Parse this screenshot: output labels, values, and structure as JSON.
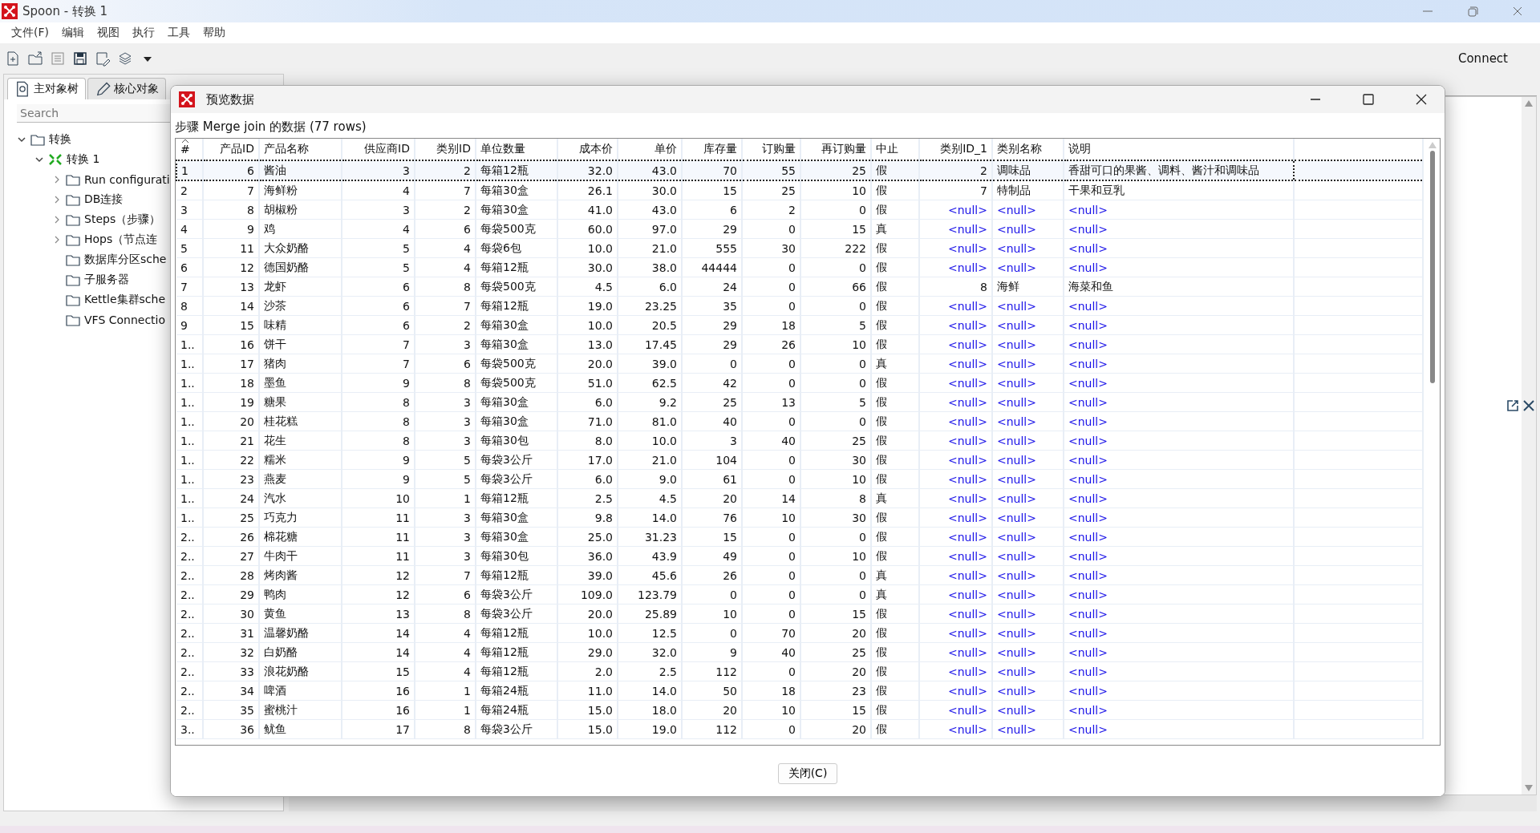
{
  "window": {
    "title": "Spoon - 转换 1"
  },
  "menu": [
    "文件(F)",
    "编辑",
    "视图",
    "执行",
    "工具",
    "帮助"
  ],
  "toolbar": {
    "connect": "Connect"
  },
  "sidebar": {
    "tabs": [
      {
        "label": "主对象树",
        "selected": true
      },
      {
        "label": "核心对象",
        "selected": false
      }
    ],
    "search": {
      "placeholder": "Search"
    },
    "tree": [
      {
        "label": "转换",
        "kind": "folder",
        "expanded": true,
        "children": [
          {
            "label": "转换 1",
            "kind": "transformation",
            "expanded": true,
            "children": [
              {
                "label": "Run configurati",
                "kind": "folder",
                "expanded": false
              },
              {
                "label": "DB连接",
                "kind": "folder",
                "expanded": false
              },
              {
                "label": "Steps（步骤）",
                "kind": "folder",
                "expanded": false
              },
              {
                "label": "Hops（节点连",
                "kind": "folder",
                "expanded": false
              },
              {
                "label": "数据库分区sche",
                "kind": "folder"
              },
              {
                "label": "子服务器",
                "kind": "folder"
              },
              {
                "label": "Kettle集群sche",
                "kind": "folder"
              },
              {
                "label": "VFS Connectio",
                "kind": "folder"
              }
            ]
          }
        ]
      }
    ]
  },
  "dialog": {
    "title": "预览数据",
    "caption": "步骤 Merge join 的数据  (77 rows)",
    "columns": [
      {
        "label": "#",
        "kind": "text"
      },
      {
        "label": "产品ID",
        "kind": "number"
      },
      {
        "label": "产品名称",
        "kind": "text"
      },
      {
        "label": "供应商ID",
        "kind": "number"
      },
      {
        "label": "类别ID",
        "kind": "number"
      },
      {
        "label": "单位数量",
        "kind": "text"
      },
      {
        "label": "成本价",
        "kind": "number"
      },
      {
        "label": "单价",
        "kind": "number"
      },
      {
        "label": "库存量",
        "kind": "number"
      },
      {
        "label": "订购量",
        "kind": "number"
      },
      {
        "label": "再订购量",
        "kind": "number"
      },
      {
        "label": "中止",
        "kind": "text"
      },
      {
        "label": "类别ID_1",
        "kind": "number"
      },
      {
        "label": "类别名称",
        "kind": "text"
      },
      {
        "label": "说明",
        "kind": "text"
      }
    ],
    "rows": [
      {
        "selected": true,
        "joined": true,
        "cells": [
          "1",
          "6",
          "酱油",
          "3",
          "2",
          "每箱12瓶",
          "32.0",
          "43.0",
          "70",
          "55",
          "25",
          "假",
          "2",
          "调味品",
          "香甜可口的果酱、调料、酱汁和调味品"
        ]
      },
      {
        "selected": false,
        "joined": true,
        "cells": [
          "2",
          "7",
          "海鲜粉",
          "4",
          "7",
          "每箱30盒",
          "26.1",
          "30.0",
          "15",
          "25",
          "10",
          "假",
          "7",
          "特制品",
          "干果和豆乳"
        ]
      },
      {
        "selected": false,
        "joined": false,
        "cells": [
          "3",
          "8",
          "胡椒粉",
          "3",
          "2",
          "每箱30盒",
          "41.0",
          "43.0",
          "6",
          "2",
          "0",
          "假",
          "<null>",
          "<null>",
          "<null>"
        ]
      },
      {
        "selected": false,
        "joined": false,
        "cells": [
          "4",
          "9",
          "鸡",
          "4",
          "6",
          "每袋500克",
          "60.0",
          "97.0",
          "29",
          "0",
          "15",
          "真",
          "<null>",
          "<null>",
          "<null>"
        ]
      },
      {
        "selected": false,
        "joined": false,
        "cells": [
          "5",
          "11",
          "大众奶酪",
          "5",
          "4",
          "每袋6包",
          "10.0",
          "21.0",
          "555",
          "30",
          "222",
          "假",
          "<null>",
          "<null>",
          "<null>"
        ]
      },
      {
        "selected": false,
        "joined": false,
        "cells": [
          "6",
          "12",
          "德国奶酪",
          "5",
          "4",
          "每箱12瓶",
          "30.0",
          "38.0",
          "44444",
          "0",
          "0",
          "假",
          "<null>",
          "<null>",
          "<null>"
        ]
      },
      {
        "selected": false,
        "joined": true,
        "cells": [
          "7",
          "13",
          "龙虾",
          "6",
          "8",
          "每袋500克",
          "4.5",
          "6.0",
          "24",
          "0",
          "66",
          "假",
          "8",
          "海鲜",
          "海菜和鱼"
        ]
      },
      {
        "selected": false,
        "joined": false,
        "cells": [
          "8",
          "14",
          "沙茶",
          "6",
          "7",
          "每箱12瓶",
          "19.0",
          "23.25",
          "35",
          "0",
          "0",
          "假",
          "<null>",
          "<null>",
          "<null>"
        ]
      },
      {
        "selected": false,
        "joined": false,
        "cells": [
          "9",
          "15",
          "味精",
          "6",
          "2",
          "每箱30盒",
          "10.0",
          "20.5",
          "29",
          "18",
          "5",
          "假",
          "<null>",
          "<null>",
          "<null>"
        ]
      },
      {
        "selected": false,
        "joined": false,
        "cells": [
          "1..",
          "16",
          "饼干",
          "7",
          "3",
          "每箱30盒",
          "13.0",
          "17.45",
          "29",
          "26",
          "10",
          "假",
          "<null>",
          "<null>",
          "<null>"
        ]
      },
      {
        "selected": false,
        "joined": false,
        "cells": [
          "1..",
          "17",
          "猪肉",
          "7",
          "6",
          "每袋500克",
          "20.0",
          "39.0",
          "0",
          "0",
          "0",
          "真",
          "<null>",
          "<null>",
          "<null>"
        ]
      },
      {
        "selected": false,
        "joined": false,
        "cells": [
          "1..",
          "18",
          "墨鱼",
          "9",
          "8",
          "每袋500克",
          "51.0",
          "62.5",
          "42",
          "0",
          "0",
          "假",
          "<null>",
          "<null>",
          "<null>"
        ]
      },
      {
        "selected": false,
        "joined": false,
        "cells": [
          "1..",
          "19",
          "糖果",
          "8",
          "3",
          "每箱30盒",
          "6.0",
          "9.2",
          "25",
          "13",
          "5",
          "假",
          "<null>",
          "<null>",
          "<null>"
        ]
      },
      {
        "selected": false,
        "joined": false,
        "cells": [
          "1..",
          "20",
          "桂花糕",
          "8",
          "3",
          "每箱30盒",
          "71.0",
          "81.0",
          "40",
          "0",
          "0",
          "假",
          "<null>",
          "<null>",
          "<null>"
        ]
      },
      {
        "selected": false,
        "joined": false,
        "cells": [
          "1..",
          "21",
          "花生",
          "8",
          "3",
          "每箱30包",
          "8.0",
          "10.0",
          "3",
          "40",
          "25",
          "假",
          "<null>",
          "<null>",
          "<null>"
        ]
      },
      {
        "selected": false,
        "joined": false,
        "cells": [
          "1..",
          "22",
          "糯米",
          "9",
          "5",
          "每袋3公斤",
          "17.0",
          "21.0",
          "104",
          "0",
          "30",
          "假",
          "<null>",
          "<null>",
          "<null>"
        ]
      },
      {
        "selected": false,
        "joined": false,
        "cells": [
          "1..",
          "23",
          "燕麦",
          "9",
          "5",
          "每袋3公斤",
          "6.0",
          "9.0",
          "61",
          "0",
          "10",
          "假",
          "<null>",
          "<null>",
          "<null>"
        ]
      },
      {
        "selected": false,
        "joined": false,
        "cells": [
          "1..",
          "24",
          "汽水",
          "10",
          "1",
          "每箱12瓶",
          "2.5",
          "4.5",
          "20",
          "14",
          "8",
          "真",
          "<null>",
          "<null>",
          "<null>"
        ]
      },
      {
        "selected": false,
        "joined": false,
        "cells": [
          "1..",
          "25",
          "巧克力",
          "11",
          "3",
          "每箱30盒",
          "9.8",
          "14.0",
          "76",
          "10",
          "30",
          "假",
          "<null>",
          "<null>",
          "<null>"
        ]
      },
      {
        "selected": false,
        "joined": false,
        "cells": [
          "2..",
          "26",
          "棉花糖",
          "11",
          "3",
          "每箱30盒",
          "25.0",
          "31.23",
          "15",
          "0",
          "0",
          "假",
          "<null>",
          "<null>",
          "<null>"
        ]
      },
      {
        "selected": false,
        "joined": false,
        "cells": [
          "2..",
          "27",
          "牛肉干",
          "11",
          "3",
          "每箱30包",
          "36.0",
          "43.9",
          "49",
          "0",
          "10",
          "假",
          "<null>",
          "<null>",
          "<null>"
        ]
      },
      {
        "selected": false,
        "joined": false,
        "cells": [
          "2..",
          "28",
          "烤肉酱",
          "12",
          "7",
          "每箱12瓶",
          "39.0",
          "45.6",
          "26",
          "0",
          "0",
          "真",
          "<null>",
          "<null>",
          "<null>"
        ]
      },
      {
        "selected": false,
        "joined": false,
        "cells": [
          "2..",
          "29",
          "鸭肉",
          "12",
          "6",
          "每袋3公斤",
          "109.0",
          "123.79",
          "0",
          "0",
          "0",
          "真",
          "<null>",
          "<null>",
          "<null>"
        ]
      },
      {
        "selected": false,
        "joined": false,
        "cells": [
          "2..",
          "30",
          "黄鱼",
          "13",
          "8",
          "每袋3公斤",
          "20.0",
          "25.89",
          "10",
          "0",
          "15",
          "假",
          "<null>",
          "<null>",
          "<null>"
        ]
      },
      {
        "selected": false,
        "joined": false,
        "cells": [
          "2..",
          "31",
          "温馨奶酪",
          "14",
          "4",
          "每箱12瓶",
          "10.0",
          "12.5",
          "0",
          "70",
          "20",
          "假",
          "<null>",
          "<null>",
          "<null>"
        ]
      },
      {
        "selected": false,
        "joined": false,
        "cells": [
          "2..",
          "32",
          "白奶酪",
          "14",
          "4",
          "每箱12瓶",
          "29.0",
          "32.0",
          "9",
          "40",
          "25",
          "假",
          "<null>",
          "<null>",
          "<null>"
        ]
      },
      {
        "selected": false,
        "joined": false,
        "cells": [
          "2..",
          "33",
          "浪花奶酪",
          "15",
          "4",
          "每箱12瓶",
          "2.0",
          "2.5",
          "112",
          "0",
          "20",
          "假",
          "<null>",
          "<null>",
          "<null>"
        ]
      },
      {
        "selected": false,
        "joined": false,
        "cells": [
          "2..",
          "34",
          "啤酒",
          "16",
          "1",
          "每箱24瓶",
          "11.0",
          "14.0",
          "50",
          "18",
          "23",
          "假",
          "<null>",
          "<null>",
          "<null>"
        ]
      },
      {
        "selected": false,
        "joined": false,
        "cells": [
          "2..",
          "35",
          "蜜桃汁",
          "16",
          "1",
          "每箱24瓶",
          "15.0",
          "18.0",
          "20",
          "10",
          "15",
          "假",
          "<null>",
          "<null>",
          "<null>"
        ]
      },
      {
        "selected": false,
        "joined": false,
        "cells": [
          "3..",
          "36",
          "鱿鱼",
          "17",
          "8",
          "每袋3公斤",
          "15.0",
          "19.0",
          "112",
          "0",
          "20",
          "假",
          "<null>",
          "<null>",
          "<null>"
        ]
      }
    ],
    "close_button": "关闭(C)"
  }
}
